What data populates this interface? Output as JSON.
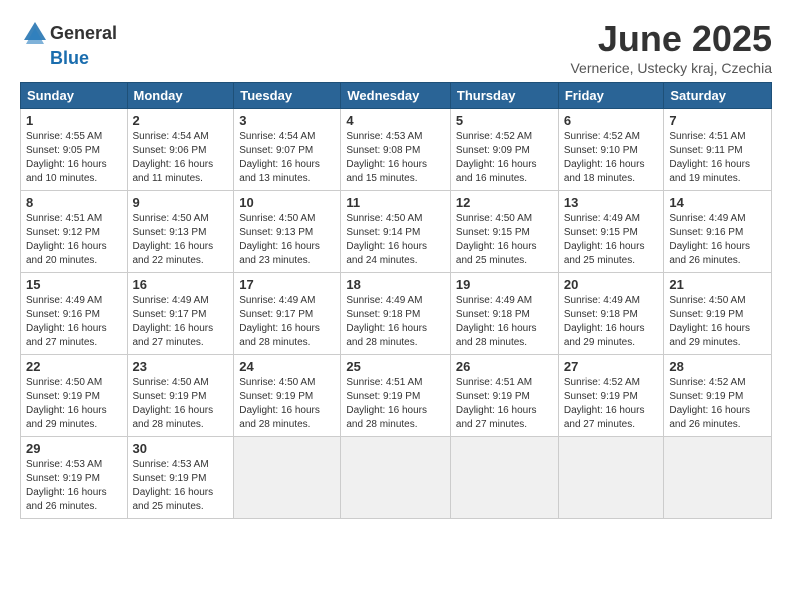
{
  "header": {
    "logo_general": "General",
    "logo_blue": "Blue",
    "month_title": "June 2025",
    "location": "Vernerice, Ustecky kraj, Czechia"
  },
  "weekdays": [
    "Sunday",
    "Monday",
    "Tuesday",
    "Wednesday",
    "Thursday",
    "Friday",
    "Saturday"
  ],
  "weeks": [
    [
      {
        "day": "1",
        "sunrise": "4:55 AM",
        "sunset": "9:05 PM",
        "daylight": "16 hours and 10 minutes."
      },
      {
        "day": "2",
        "sunrise": "4:54 AM",
        "sunset": "9:06 PM",
        "daylight": "16 hours and 11 minutes."
      },
      {
        "day": "3",
        "sunrise": "4:54 AM",
        "sunset": "9:07 PM",
        "daylight": "16 hours and 13 minutes."
      },
      {
        "day": "4",
        "sunrise": "4:53 AM",
        "sunset": "9:08 PM",
        "daylight": "16 hours and 15 minutes."
      },
      {
        "day": "5",
        "sunrise": "4:52 AM",
        "sunset": "9:09 PM",
        "daylight": "16 hours and 16 minutes."
      },
      {
        "day": "6",
        "sunrise": "4:52 AM",
        "sunset": "9:10 PM",
        "daylight": "16 hours and 18 minutes."
      },
      {
        "day": "7",
        "sunrise": "4:51 AM",
        "sunset": "9:11 PM",
        "daylight": "16 hours and 19 minutes."
      }
    ],
    [
      {
        "day": "8",
        "sunrise": "4:51 AM",
        "sunset": "9:12 PM",
        "daylight": "16 hours and 20 minutes."
      },
      {
        "day": "9",
        "sunrise": "4:50 AM",
        "sunset": "9:13 PM",
        "daylight": "16 hours and 22 minutes."
      },
      {
        "day": "10",
        "sunrise": "4:50 AM",
        "sunset": "9:13 PM",
        "daylight": "16 hours and 23 minutes."
      },
      {
        "day": "11",
        "sunrise": "4:50 AM",
        "sunset": "9:14 PM",
        "daylight": "16 hours and 24 minutes."
      },
      {
        "day": "12",
        "sunrise": "4:50 AM",
        "sunset": "9:15 PM",
        "daylight": "16 hours and 25 minutes."
      },
      {
        "day": "13",
        "sunrise": "4:49 AM",
        "sunset": "9:15 PM",
        "daylight": "16 hours and 25 minutes."
      },
      {
        "day": "14",
        "sunrise": "4:49 AM",
        "sunset": "9:16 PM",
        "daylight": "16 hours and 26 minutes."
      }
    ],
    [
      {
        "day": "15",
        "sunrise": "4:49 AM",
        "sunset": "9:16 PM",
        "daylight": "16 hours and 27 minutes."
      },
      {
        "day": "16",
        "sunrise": "4:49 AM",
        "sunset": "9:17 PM",
        "daylight": "16 hours and 27 minutes."
      },
      {
        "day": "17",
        "sunrise": "4:49 AM",
        "sunset": "9:17 PM",
        "daylight": "16 hours and 28 minutes."
      },
      {
        "day": "18",
        "sunrise": "4:49 AM",
        "sunset": "9:18 PM",
        "daylight": "16 hours and 28 minutes."
      },
      {
        "day": "19",
        "sunrise": "4:49 AM",
        "sunset": "9:18 PM",
        "daylight": "16 hours and 28 minutes."
      },
      {
        "day": "20",
        "sunrise": "4:49 AM",
        "sunset": "9:18 PM",
        "daylight": "16 hours and 29 minutes."
      },
      {
        "day": "21",
        "sunrise": "4:50 AM",
        "sunset": "9:19 PM",
        "daylight": "16 hours and 29 minutes."
      }
    ],
    [
      {
        "day": "22",
        "sunrise": "4:50 AM",
        "sunset": "9:19 PM",
        "daylight": "16 hours and 29 minutes."
      },
      {
        "day": "23",
        "sunrise": "4:50 AM",
        "sunset": "9:19 PM",
        "daylight": "16 hours and 28 minutes."
      },
      {
        "day": "24",
        "sunrise": "4:50 AM",
        "sunset": "9:19 PM",
        "daylight": "16 hours and 28 minutes."
      },
      {
        "day": "25",
        "sunrise": "4:51 AM",
        "sunset": "9:19 PM",
        "daylight": "16 hours and 28 minutes."
      },
      {
        "day": "26",
        "sunrise": "4:51 AM",
        "sunset": "9:19 PM",
        "daylight": "16 hours and 27 minutes."
      },
      {
        "day": "27",
        "sunrise": "4:52 AM",
        "sunset": "9:19 PM",
        "daylight": "16 hours and 27 minutes."
      },
      {
        "day": "28",
        "sunrise": "4:52 AM",
        "sunset": "9:19 PM",
        "daylight": "16 hours and 26 minutes."
      }
    ],
    [
      {
        "day": "29",
        "sunrise": "4:53 AM",
        "sunset": "9:19 PM",
        "daylight": "16 hours and 26 minutes."
      },
      {
        "day": "30",
        "sunrise": "4:53 AM",
        "sunset": "9:19 PM",
        "daylight": "16 hours and 25 minutes."
      },
      null,
      null,
      null,
      null,
      null
    ]
  ]
}
